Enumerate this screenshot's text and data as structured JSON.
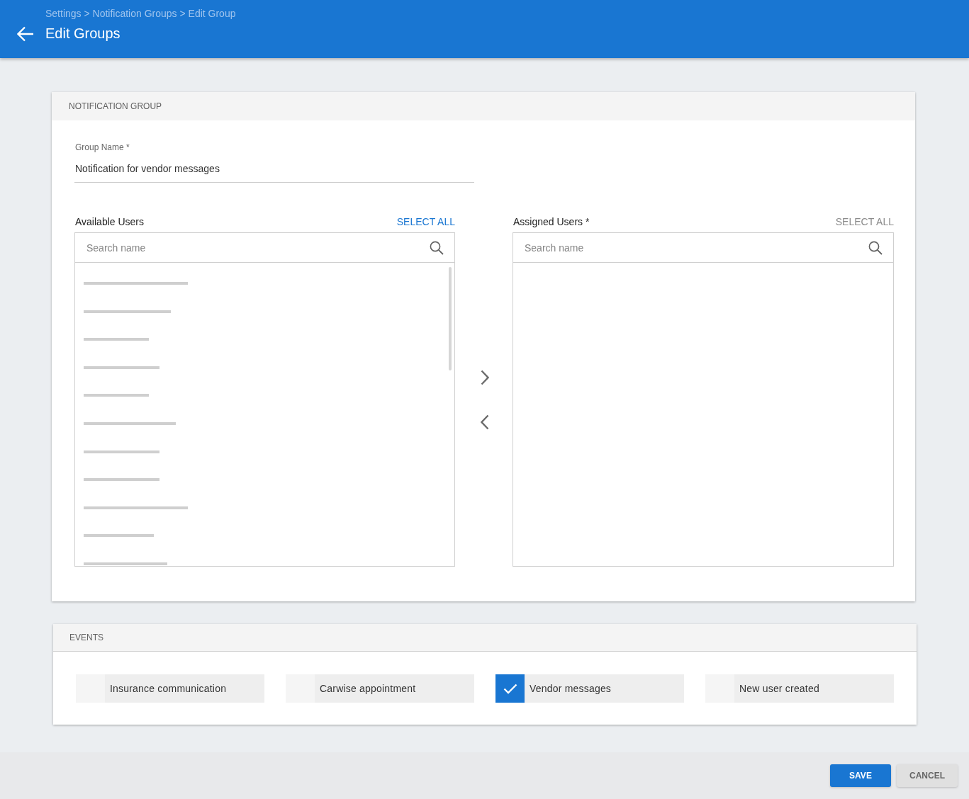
{
  "header": {
    "breadcrumb": "Settings > Notification Groups > Edit Group",
    "title": "Edit Groups"
  },
  "notification_group": {
    "heading": "NOTIFICATION GROUP",
    "group_name": {
      "label": "Group Name *",
      "value": "Notification for vendor messages"
    },
    "available_users": {
      "label": "Available Users",
      "select_all": {
        "label": "SELECT ALL",
        "disabled": false
      },
      "search": {
        "placeholder": "Search name"
      },
      "loading": true
    },
    "assigned_users": {
      "label": "Assigned Users *",
      "select_all": {
        "label": "SELECT ALL",
        "disabled": true
      },
      "search": {
        "placeholder": "Search name"
      },
      "loading": false
    }
  },
  "events": {
    "heading": "EVENTS",
    "items": [
      {
        "label": "Insurance communication",
        "checked": false
      },
      {
        "label": "Carwise appointment",
        "checked": false
      },
      {
        "label": "Vendor messages",
        "checked": true
      },
      {
        "label": "New user created",
        "checked": false
      }
    ]
  },
  "footer": {
    "buttons": [
      {
        "label": "SAVE",
        "kind": "primary"
      },
      {
        "label": "CANCEL",
        "kind": "secondary"
      }
    ]
  }
}
